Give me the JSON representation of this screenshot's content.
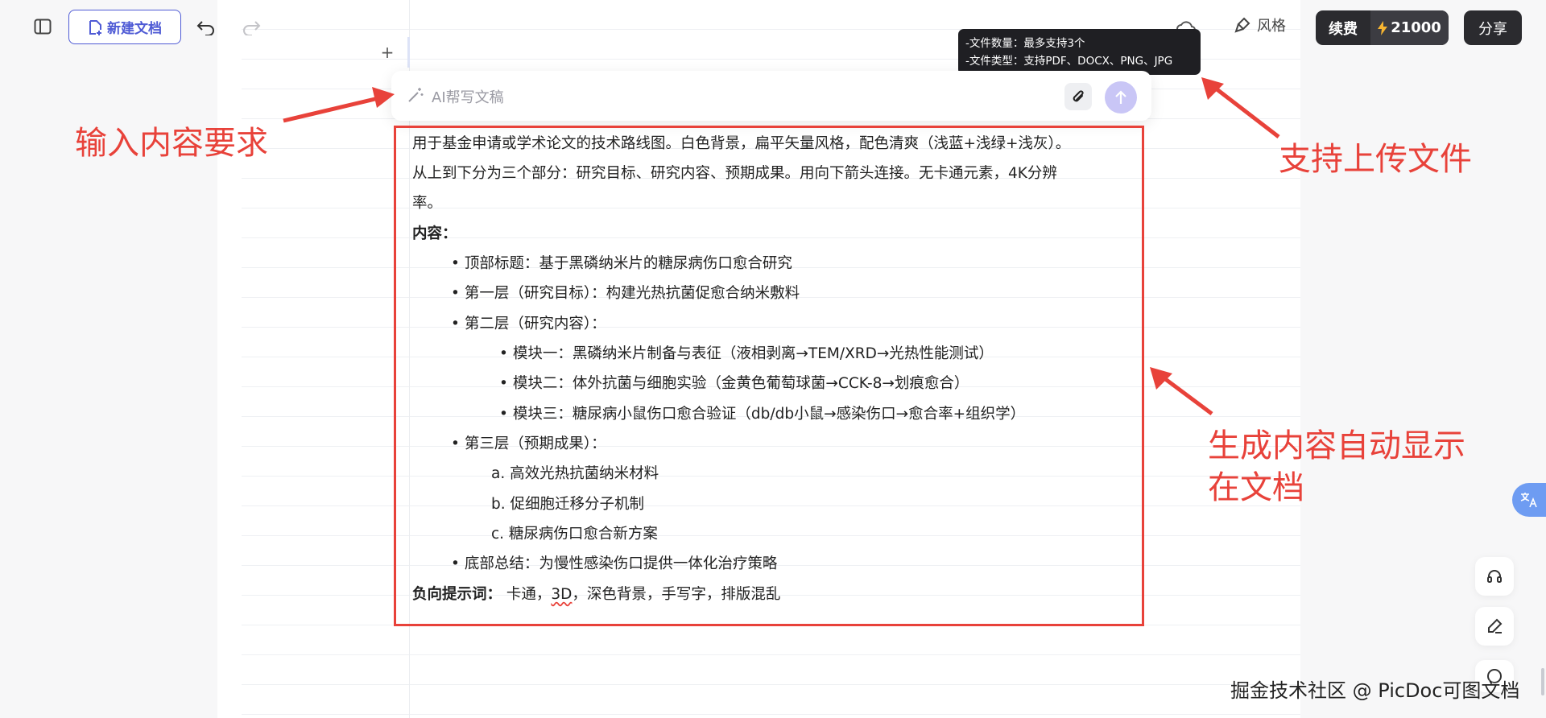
{
  "toolbar": {
    "new_doc_label": "新建文档",
    "style_label": "风格",
    "renew_label": "续费",
    "credits": "21000",
    "share_label": "分享"
  },
  "tooltip": {
    "line1": "-文件数量：最多支持3个",
    "line2": "-文件类型：支持PDF、DOCX、PNG、JPG"
  },
  "ai_input": {
    "placeholder": "AI帮写文稿"
  },
  "content": {
    "intro1": "用于基金申请或学术论文的技术路线图。白色背景，扁平矢量风格，配色清爽（浅蓝+浅绿+浅灰）。",
    "intro2": "从上到下分为三个部分：研究目标、研究内容、预期成果。用向下箭头连接。无卡通元素，4K分辨",
    "intro3": "率。",
    "content_heading": "内容：",
    "items": [
      "顶部标题：基于黑磷纳米片的糖尿病伤口愈合研究",
      "第一层（研究目标）：构建光热抗菌促愈合纳米敷料",
      "第二层（研究内容）："
    ],
    "modules": [
      "模块一：黑磷纳米片制备与表征（液相剥离→TEM/XRD→光热性能测试）",
      "模块二：体外抗菌与细胞实验（金黄色葡萄球菌→CCK-8→划痕愈合）",
      "模块三：糖尿病小鼠伤口愈合验证（db/db小鼠→感染伤口→愈合率+组织学）"
    ],
    "layer3": "第三层（预期成果）：",
    "outcomes": [
      "a. 高效光热抗菌纳米材料",
      "b. 促细胞迁移分子机制",
      "c. 糖尿病伤口愈合新方案"
    ],
    "bottom": "底部总结：为慢性感染伤口提供一体化治疗策略",
    "negative_label": "负向提示词：",
    "negative_pre": " 卡通，",
    "negative_3d": "3D",
    "negative_post": "，深色背景，手写字，排版混乱"
  },
  "annotations": {
    "input_hint": "输入内容要求",
    "upload_hint": "支持上传文件",
    "auto_display_1": "生成内容自动显示",
    "auto_display_2": "在文档"
  },
  "watermark": "掘金技术社区 @ PicDoc可图文档",
  "colors": {
    "accent": "#4f5bd5",
    "annotation_red": "#e8423a",
    "dark_button": "#2b2b2f",
    "send_disabled": "#c9c6f6"
  }
}
